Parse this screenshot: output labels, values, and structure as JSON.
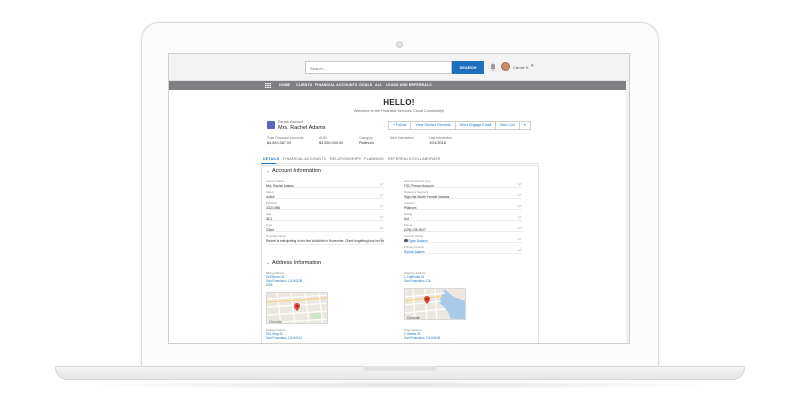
{
  "topbar": {
    "search_placeholder": "Search...",
    "search_button": "SEARCH",
    "user_name": "Carole K",
    "user_caret": "▾"
  },
  "nav": {
    "items": [
      "HOME",
      "CLIENTS",
      "FINANCIAL ACCOUNTS",
      "GOALS",
      "ALL",
      "LEADS AND REFERRALS"
    ]
  },
  "hero": {
    "title": "HELLO!",
    "subtitle": "Welcome to the Financial Services Cloud Community!"
  },
  "account": {
    "type": "Person Account",
    "name": "Mrs. Rachel Adams",
    "actions": [
      "+ Follow",
      "View Service Records",
      "Send Engage Email",
      "Item Coo",
      "▾"
    ]
  },
  "stats": [
    {
      "label": "Total Financial Accounts",
      "value": "$4,849,387.00"
    },
    {
      "label": "AUM",
      "value": "$3,550,000.00"
    },
    {
      "label": "Category",
      "value": "Platinum"
    },
    {
      "label": "Next Interaction",
      "value": ""
    },
    {
      "label": "Last Interaction",
      "value": "1/24/2018"
    }
  ],
  "tabs": [
    "DETAILS",
    "FINANCIAL ACCOUNTS",
    "RELATIONSHIPS",
    "PLANNING",
    "REFERRALS",
    "COLLABORATE"
  ],
  "account_info": {
    "title": "Account Information",
    "left": [
      {
        "label": "Account Name",
        "value": "Mrs. Rachel Adams"
      },
      {
        "label": "Status",
        "value": "Active"
      },
      {
        "label": "Birthdate",
        "value": "3/12/1980"
      },
      {
        "label": "Age",
        "value": "38.1"
      },
      {
        "label": "Type",
        "value": "Client"
      },
      {
        "label": "Important Notes",
        "value": "Rachel is anticipating in her first childbirth in November. Client forgetting took her wealth"
      }
    ],
    "right": [
      {
        "label": "Account Record Type",
        "value": "FSC Person Account"
      },
      {
        "label": "Marketing Segment",
        "value": "High Net Worth Female Investor"
      },
      {
        "label": "Category",
        "value": "Platinum"
      },
      {
        "label": "Rating",
        "value": "Hot"
      },
      {
        "label": "Phone",
        "value": "(925) 236-9007"
      },
      {
        "label": "Account Owner",
        "value": "Ryan Dobson"
      },
      {
        "label": "Primary Contact",
        "value": "Rachel Adams"
      }
    ]
  },
  "address_info": {
    "title": "Address Information",
    "billing": {
      "label": "Billing Address",
      "lines": [
        "24 Rincon St",
        "San Francisco, CA 94108",
        "USA"
      ]
    },
    "shipping": {
      "label": "Shipping Address",
      "lines": [
        "1 California St",
        "San Francisco, CA"
      ]
    },
    "mailing": {
      "label": "Mailing Address",
      "lines": [
        "901 King St",
        "San Francisco, CA 94110"
      ]
    },
    "other": {
      "label": "Other Address",
      "lines": [
        "1 Harbor St",
        "San Francisco, CA 94105"
      ]
    },
    "map_brand": "Google"
  }
}
